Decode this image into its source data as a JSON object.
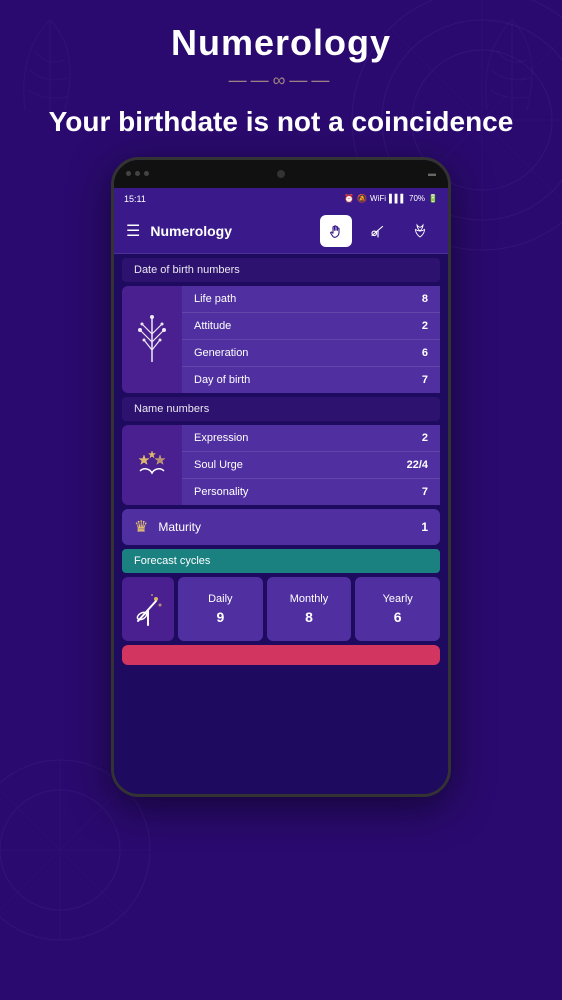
{
  "header": {
    "title": "Numerology",
    "subtitle": "Your birthdate\nis not a coincidence"
  },
  "status_bar": {
    "time": "15:11",
    "battery": "70%"
  },
  "app_bar": {
    "menu_label": "☰",
    "app_title": "Numerology"
  },
  "sections": {
    "date_of_birth": {
      "header": "Date of birth numbers",
      "rows": [
        {
          "label": "Life path",
          "value": "8"
        },
        {
          "label": "Attitude",
          "value": "2"
        },
        {
          "label": "Generation",
          "value": "6"
        },
        {
          "label": "Day of birth",
          "value": "7"
        }
      ]
    },
    "name_numbers": {
      "header": "Name numbers",
      "rows": [
        {
          "label": "Expression",
          "value": "2"
        },
        {
          "label": "Soul Urge",
          "value": "22/4"
        },
        {
          "label": "Personality",
          "value": "7"
        }
      ]
    },
    "maturity": {
      "label": "Maturity",
      "value": "1"
    },
    "forecast": {
      "header": "Forecast cycles",
      "cycles": [
        {
          "label": "Daily",
          "value": "9"
        },
        {
          "label": "Monthly",
          "value": "8"
        },
        {
          "label": "Yearly",
          "value": "6"
        }
      ]
    }
  },
  "ornament": "——∞——"
}
